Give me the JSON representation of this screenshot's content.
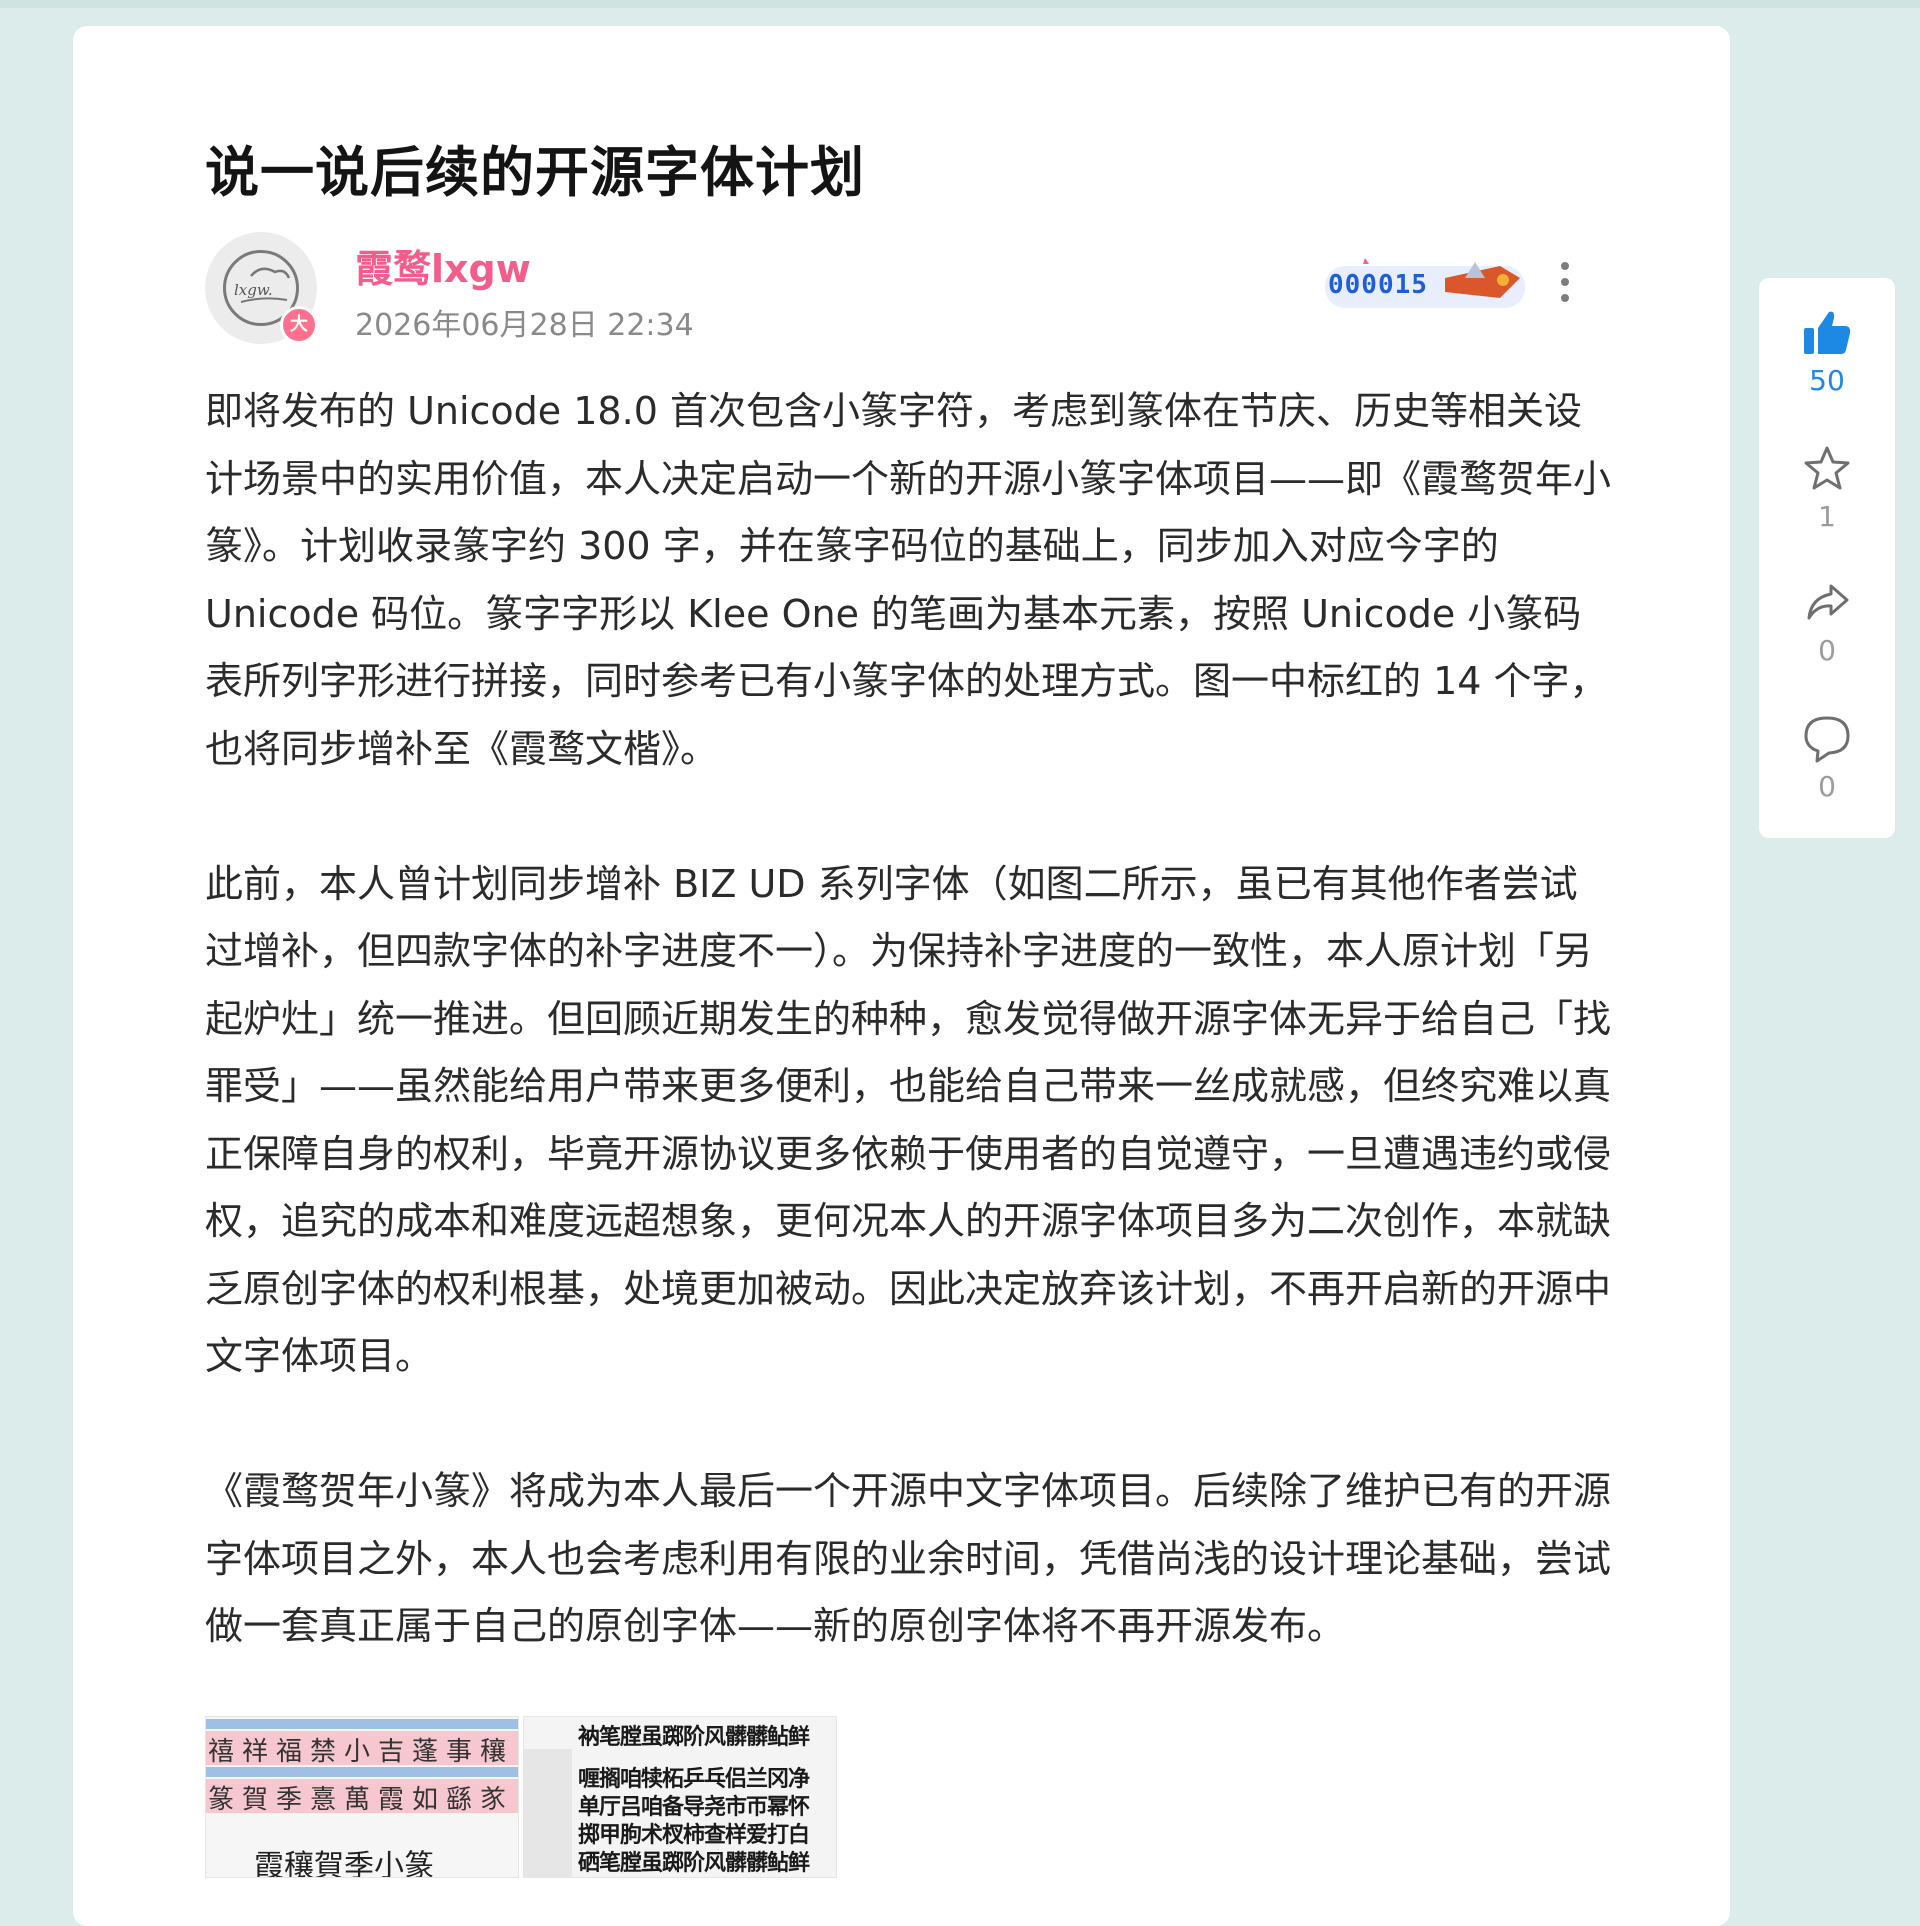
{
  "article": {
    "title": "说一说后续的开源字体计划",
    "author": {
      "name": "霞鹜lxgw",
      "avatar_text": "lxgw.",
      "badge": "大",
      "date": "2026年06月28日 22:34"
    },
    "medal_label": "000015",
    "paragraphs": [
      "即将发布的 Unicode 18.0 首次包含小篆字符，考虑到篆体在节庆、历史等相关设计场景中的实用价值，本人决定启动一个新的开源小篆字体项目——即《霞鹜贺年小篆》。计划收录篆字约 300 字，并在篆字码位的基础上，同步加入对应今字的 Unicode 码位。篆字字形以 Klee One 的笔画为基本元素，按照 Unicode 小篆码表所列字形进行拼接，同时参考已有小篆字体的处理方式。图一中标红的 14 个字，也将同步增补至《霞鹜文楷》。",
      "此前，本人曾计划同步增补 BIZ UD 系列字体（如图二所示，虽已有其他作者尝试过增补，但四款字体的补字进度不一）。为保持补字进度的一致性，本人原计划「另起炉灶」统一推进。但回顾近期发生的种种，愈发觉得做开源字体无异于给自己「找罪受」——虽然能给用户带来更多便利，也能给自己带来一丝成就感，但终究难以真正保障自身的权利，毕竟开源协议更多依赖于使用者的自觉遵守，一旦遭遇违约或侵权，追究的成本和难度远超想象，更何况本人的开源字体项目多为二次创作，本就缺乏原创字体的权利根基，处境更加被动。因此决定放弃该计划，不再开启新的开源中文字体项目。",
      "《霞鹜贺年小篆》将成为本人最后一个开源中文字体项目。后续除了维护已有的开源字体项目之外，本人也会考虑利用有限的业余时间，凭借尚浅的设计理论基础，尝试做一套真正属于自己的原创字体——新的原创字体将不再开源发布。"
    ],
    "image1": {
      "row1": "禧祥福禁小吉蓬事穰",
      "row2": "篆賀季憙萬霞如繇㒸",
      "caption": "霞穰賀季小篆"
    },
    "image2": {
      "header": "衲笔膛虽踯阶风髒髒鲇鲜",
      "lines": [
        "喱搁咱犊柘乒乓侣兰冈净",
        "单厅吕咱备导尧市帀幂怀",
        "掷甲朐术杈柿查样爱打白",
        "硒笔膛虽踯阶风髒髒鲇鲜"
      ]
    }
  },
  "sidebar": {
    "like_count": "50",
    "favorite_count": "1",
    "share_count": "0",
    "comment_count": "0"
  },
  "colors": {
    "background": "#dcecea",
    "author": "#f45d8b",
    "accent": "#1e88e5"
  }
}
